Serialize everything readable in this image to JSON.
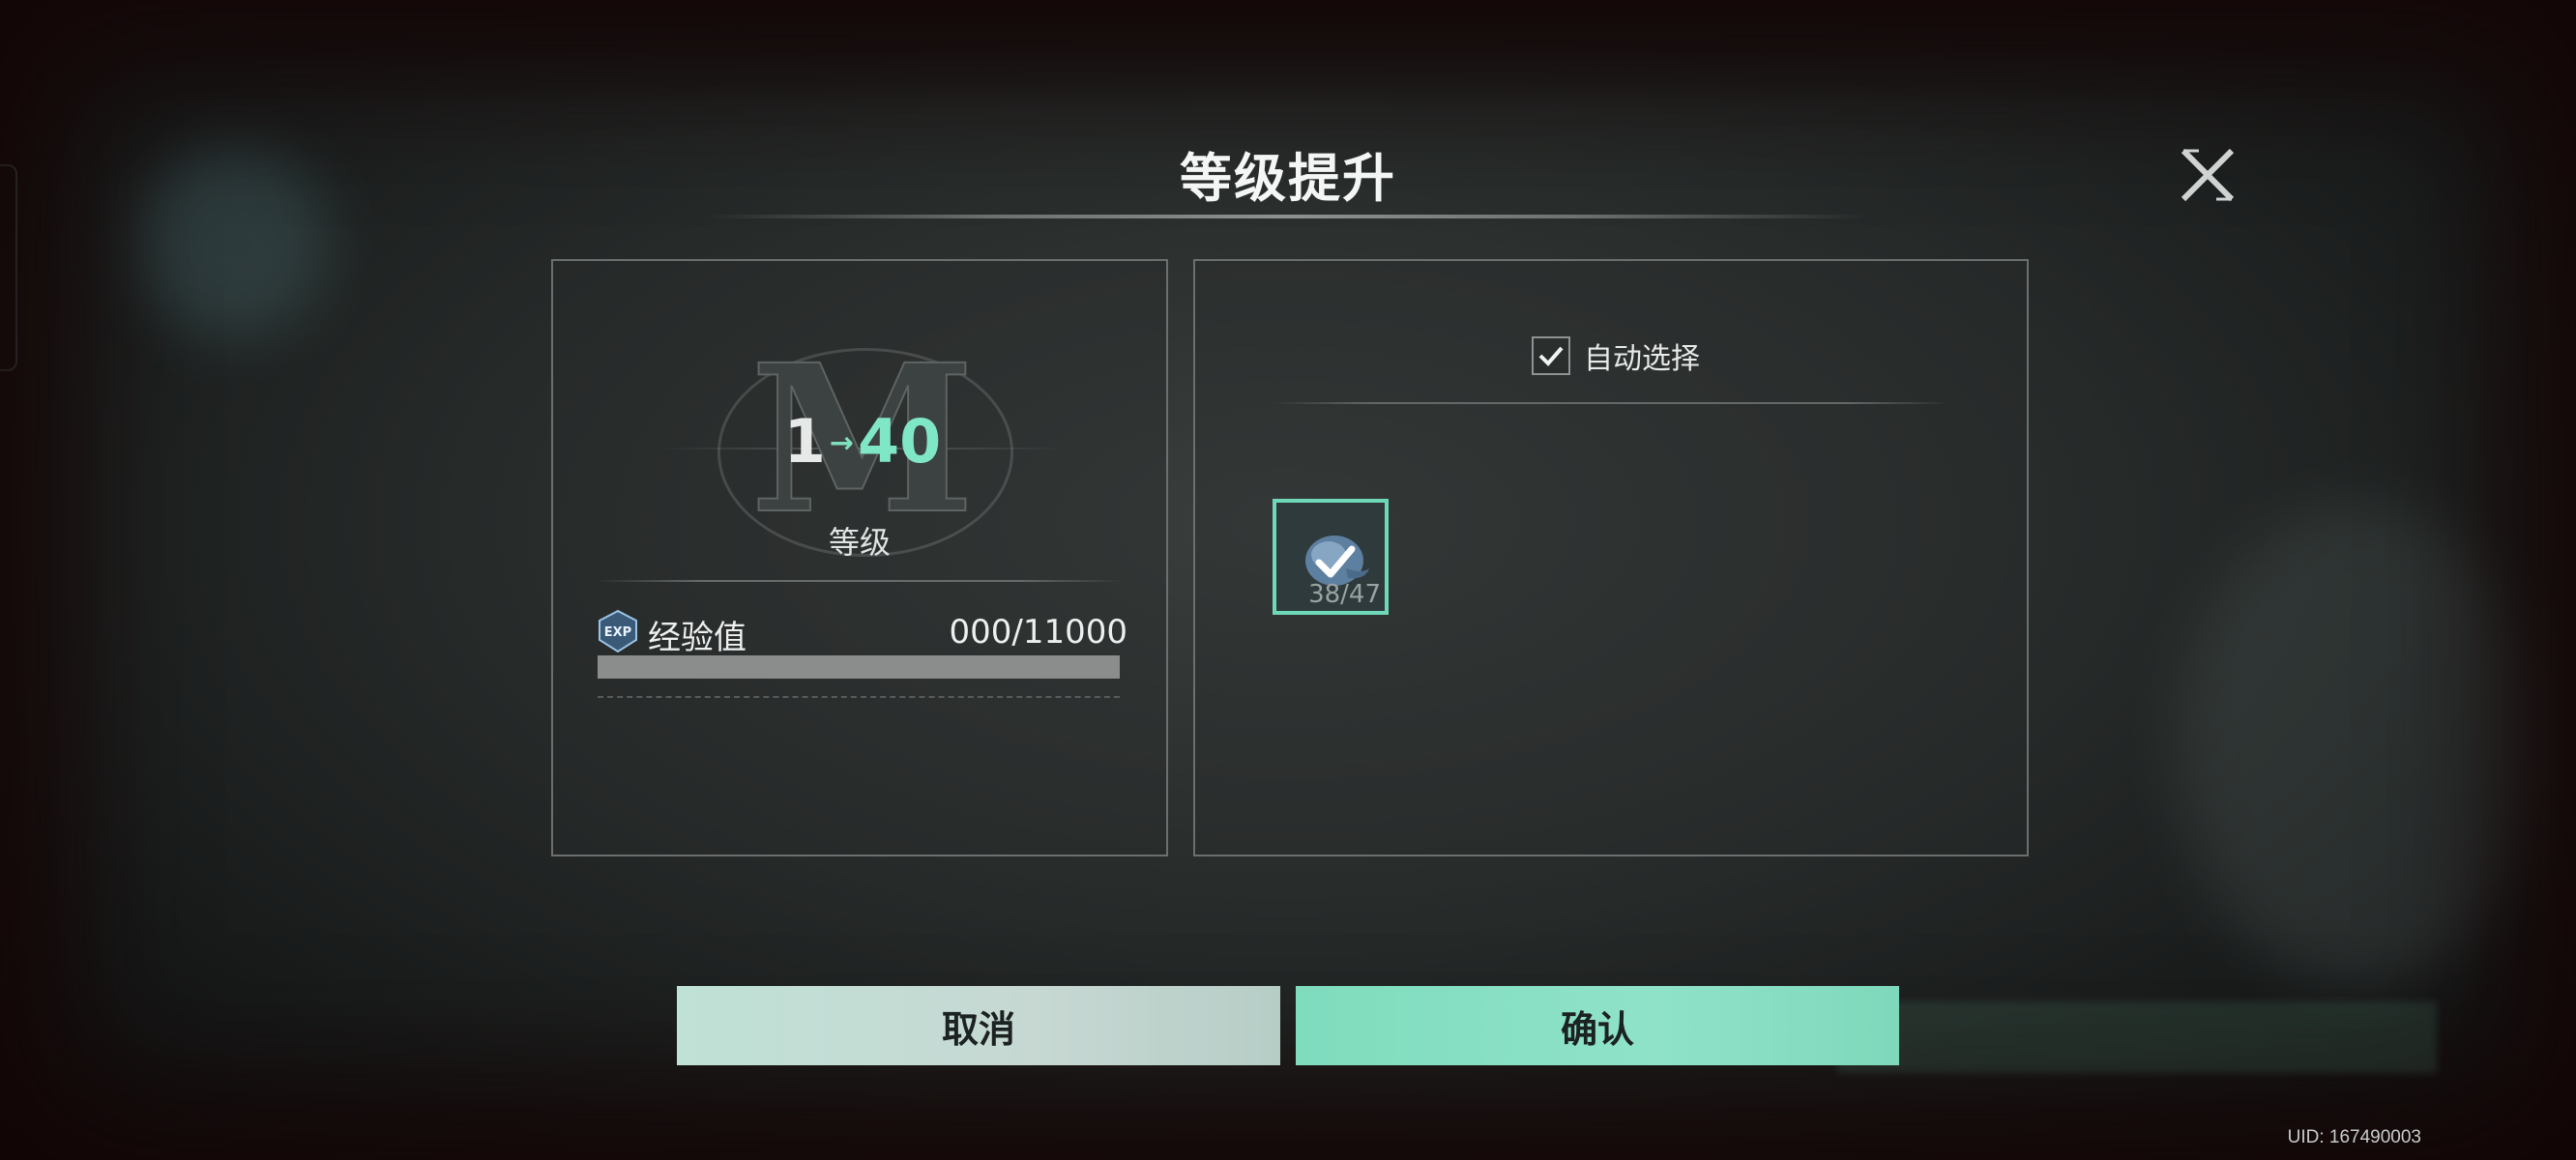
{
  "dialog": {
    "title": "等级提升",
    "close_icon": "close-icon"
  },
  "level_panel": {
    "emblem_letter": "M",
    "level_from": "1",
    "level_arrow": "→",
    "level_to": "40",
    "level_label": "等级",
    "exp_icon": "exp-badge-icon",
    "exp_label": "经验值",
    "exp_value": "000/11000",
    "exp_progress": 1.0
  },
  "material_panel": {
    "auto_select_label": "自动选择",
    "auto_select_checked": true,
    "items": [
      {
        "icon": "exp-material-icon",
        "count": "38/47",
        "selected": true
      }
    ]
  },
  "buttons": {
    "cancel_label": "取消",
    "confirm_label": "确认"
  },
  "footer": {
    "uid": "UID: 167490003"
  },
  "colors": {
    "accent": "#7fe6c6",
    "confirm_bg": "#8fe2c8",
    "cancel_bg": "#c7d8d3"
  }
}
